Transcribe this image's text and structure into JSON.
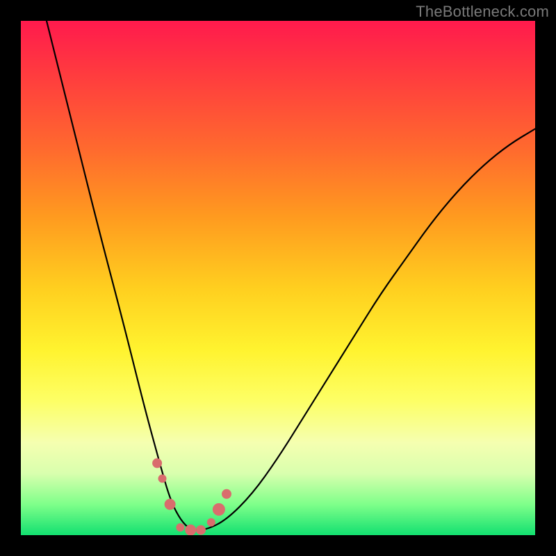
{
  "watermark": "TheBottleneck.com",
  "chart_data": {
    "type": "line",
    "title": "",
    "xlabel": "",
    "ylabel": "",
    "xlim": [
      0,
      100
    ],
    "ylim": [
      0,
      100
    ],
    "series": [
      {
        "name": "bottleneck-curve",
        "x": [
          5,
          10,
          15,
          20,
          24,
          27,
          29,
          31,
          33,
          36,
          40,
          45,
          50,
          55,
          60,
          65,
          70,
          75,
          80,
          85,
          90,
          95,
          100
        ],
        "values": [
          100,
          80,
          60,
          41,
          25,
          14,
          7,
          3,
          1,
          1,
          3,
          8,
          15,
          23,
          31,
          39,
          47,
          54,
          61,
          67,
          72,
          76,
          79
        ]
      }
    ],
    "markers": {
      "name": "highlight-dots",
      "color": "#d96d6d",
      "x": [
        26.5,
        27.5,
        29,
        31,
        33,
        35,
        37,
        38.5,
        40
      ],
      "y": [
        14,
        11,
        6,
        1.5,
        1,
        1,
        2.5,
        5,
        8
      ],
      "radius": [
        7,
        6,
        8,
        6,
        8,
        7,
        6,
        9,
        7
      ]
    },
    "highlight_band": {
      "name": "optimal-zone",
      "y_from": 0,
      "y_to": 3,
      "color": "#12e070"
    }
  }
}
